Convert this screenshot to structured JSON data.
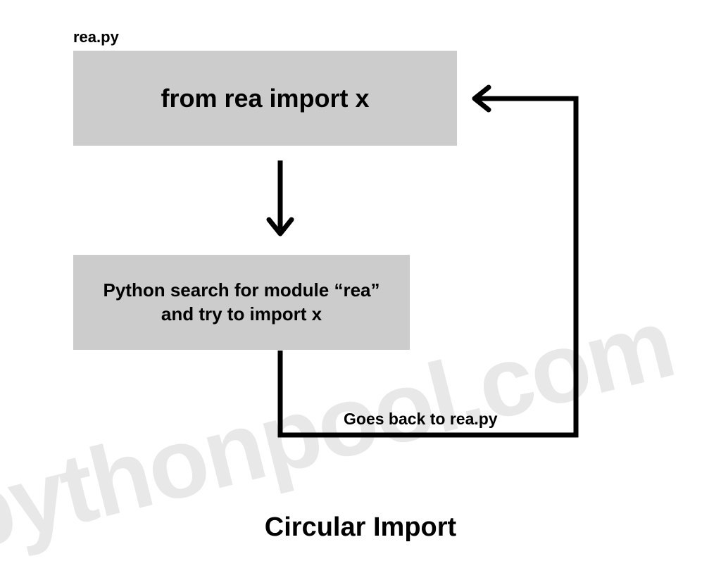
{
  "file_label": "rea.py",
  "box1_text": "from rea import x",
  "box2_line1": "Python search for module “rea”",
  "box2_line2": "and try to import x",
  "loop_label": "Goes back to rea.py",
  "title": "Circular Import",
  "watermark": "pythonpool.com"
}
